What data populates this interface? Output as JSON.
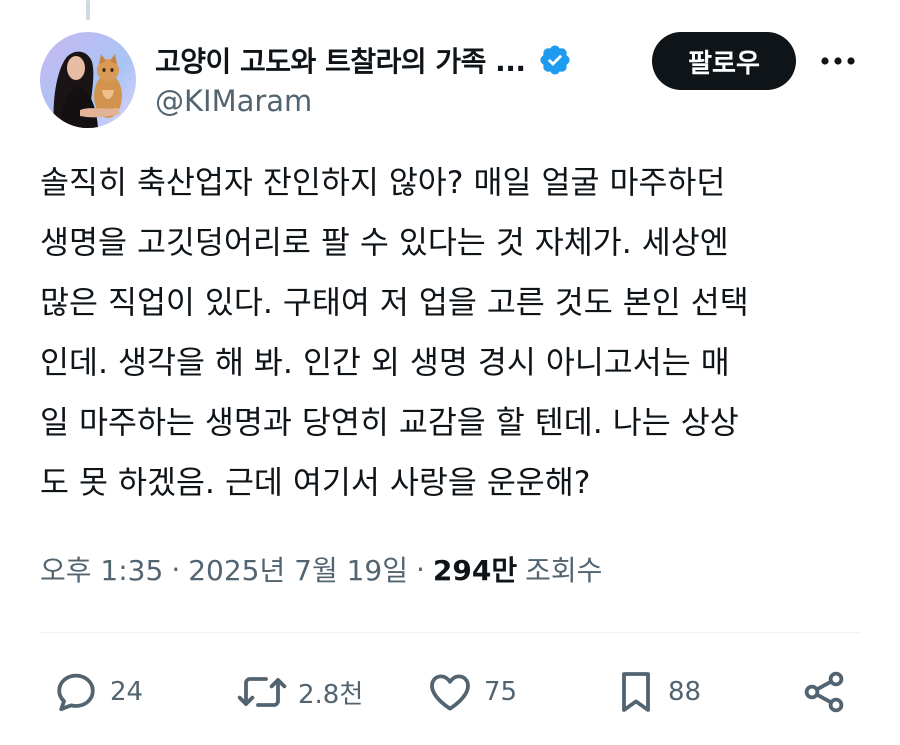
{
  "post": {
    "author": {
      "display_name": "고양이 고도와 트찰라의 가족 ...",
      "handle": "@KIMaram",
      "verified": true
    },
    "follow_label": "팔로우",
    "text_lines": [
      "솔직히 축산업자 잔인하지 않아? 매일 얼굴 마주하던",
      "생명을 고깃덩어리로 팔 수 있다는 것 자체가. 세상엔",
      "많은 직업이 있다. 구태여 저 업을 고른 것도 본인 선택",
      "인데. 생각을 해 봐. 인간 외 생명 경시 아니고서는 매",
      "일 마주하는 생명과 당연히 교감을 할 텐데. 나는 상상",
      "도 못 하겠음. 근데 여기서 사랑을 운운해?"
    ],
    "meta": {
      "time": "오후 1:35",
      "separator": "·",
      "date": "2025년 7월 19일",
      "views_count": "294만",
      "views_label": "조회수"
    },
    "actions": {
      "reply_count": "24",
      "repost_count": "2.8천",
      "like_count": "75",
      "bookmark_count": "88"
    }
  },
  "colors": {
    "text_primary": "#0f1419",
    "text_secondary": "#536471",
    "verified_blue": "#1d9bf0",
    "divider": "#eff3f4"
  },
  "icons": [
    "avatar-photo",
    "verified-badge-icon",
    "more-icon",
    "reply-icon",
    "repost-icon",
    "like-icon",
    "bookmark-icon",
    "share-icon"
  ]
}
